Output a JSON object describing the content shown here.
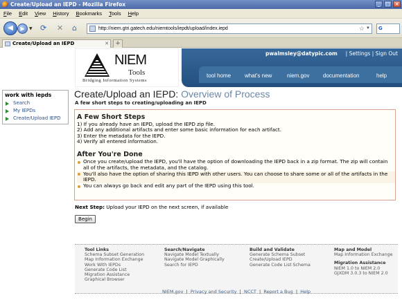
{
  "window": {
    "title": "Create/Upload an IEPD - Mozilla Firefox",
    "buttons": [
      "_",
      "□",
      "×"
    ]
  },
  "menu": [
    "File",
    "Edit",
    "View",
    "History",
    "Bookmarks",
    "Tools",
    "Help"
  ],
  "toolbar": {
    "url": "http://niem.gtri.gatech.edu/niemtools/iepdt/upload/index.iepd",
    "search_engine": "G"
  },
  "tab": {
    "label": "Create/Upload an IEPD",
    "new_tab": "+"
  },
  "logo": {
    "brand": "NIEM",
    "product": "Tools",
    "tagline": "Bridging Information Systems"
  },
  "header": {
    "user": "pwalmsley@datypic.com",
    "settings": "Settings",
    "signout": "Sign Out",
    "nav": [
      "tool home",
      "what's new",
      "niem.gov",
      "documentation",
      "help"
    ]
  },
  "sidebar": {
    "title": "work with iepds",
    "items": [
      "Search",
      "My IEPDs",
      "Create/Upload IEPD"
    ]
  },
  "main": {
    "title": "Create/Upload an IEPD:",
    "subtitle": " Overview of Process",
    "tagline": "A few short steps to creating/uploading an IEPD",
    "steps_title": "A Few Short Steps",
    "steps": [
      "1) If you already have an IEPD, upload the IEPD zip file.",
      "2) Add any additional artifacts and enter some basic information for each artifact.",
      "3) Enter the metadata for the IEPD.",
      "4) Verify all entered information."
    ],
    "after_title": "After You're Done",
    "after_items": [
      "Once you create/upload the IEPD, you'll have the option of downloading the IEPD back in a zip format. The zip will contain all of the artifacts, the metadata, and the catalog.",
      "You'll also have the option of sharing this IEPD with other users. You can choose to share some or all of the artifacts in the IEPD.",
      "You can always go back and edit any part of the IEPD using this tool."
    ],
    "next_label": "Next Step:",
    "next_text": " Upload your IEPD on the next screen, if available",
    "begin": "Begin"
  },
  "footer": {
    "tool_links": {
      "title": "Tool Links",
      "items": [
        "Schema Subset Generation",
        "Map Information Exchange",
        "Work With IEPDs",
        "Generate Code List",
        "Migration Assistance",
        "Graphical Browser"
      ]
    },
    "search_nav": {
      "title": "Search/Navigate",
      "items": [
        "Navigate Model Textually",
        "Navigate Model Graphically",
        "Search for IEPD"
      ]
    },
    "build": {
      "title": "Build and Validate",
      "items": [
        "Generate Schema Subset",
        "Create/Upload IEPD",
        "Generate Code List Schema"
      ]
    },
    "map_model": {
      "title": "Map and Model",
      "items": [
        "Map Information Exchange"
      ]
    },
    "migration": {
      "title": "Migration Assistance",
      "items": [
        "NIEM 1.0 to NIEM 2.0",
        "GJXDM 3.0.3 to NIEM 2.0"
      ]
    },
    "bottom": [
      "NIEM.gov",
      "Privacy and Security",
      "NCCT",
      "Report a Bug",
      "Help"
    ]
  }
}
